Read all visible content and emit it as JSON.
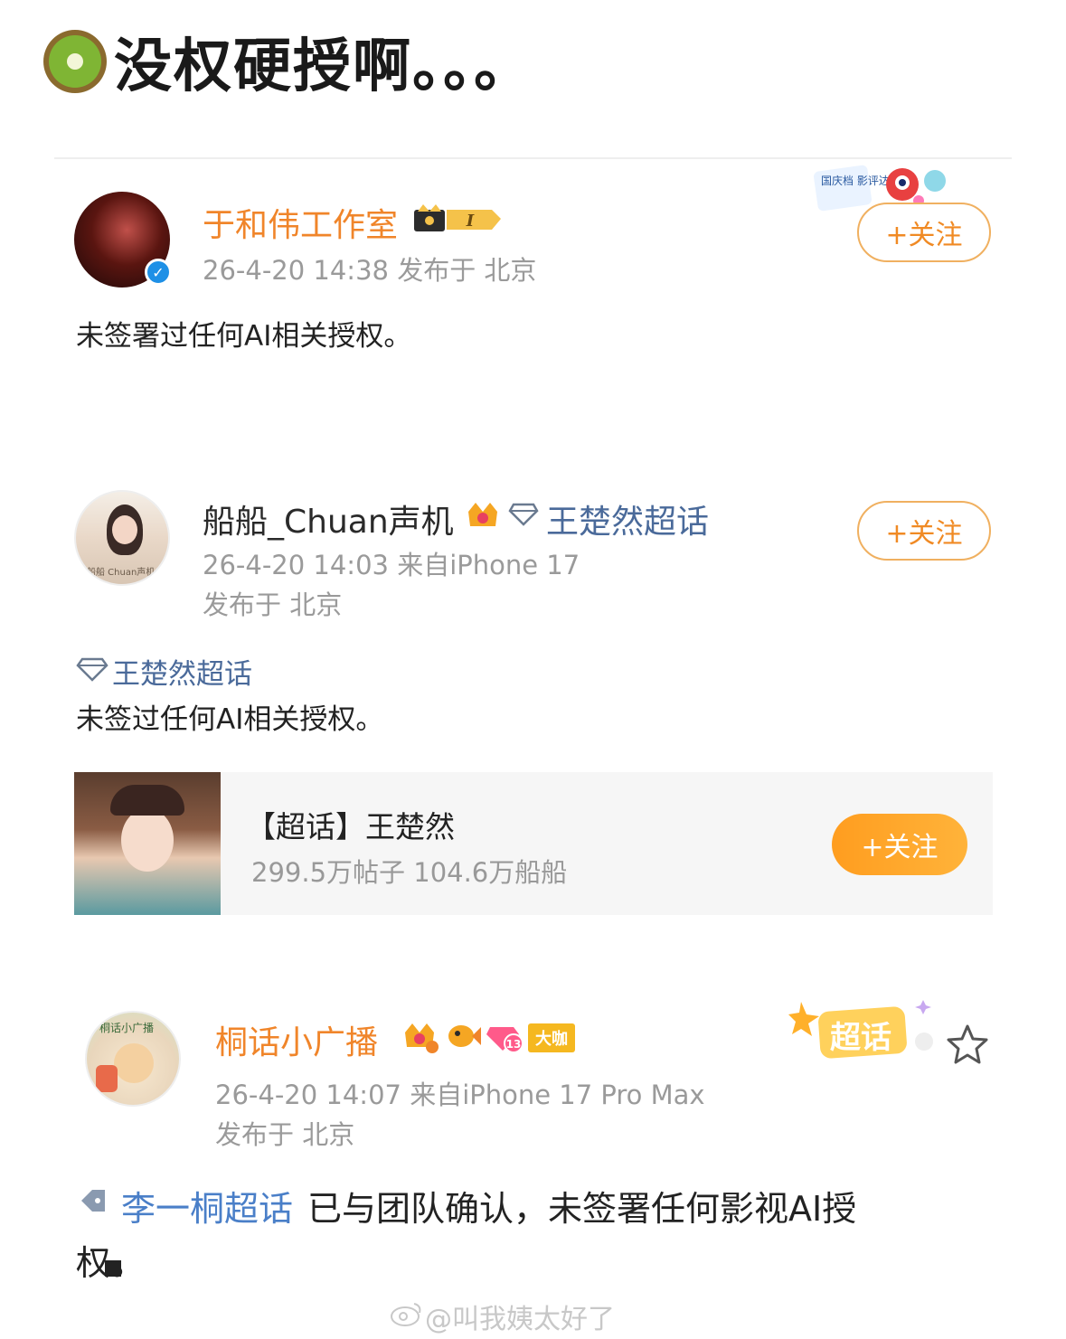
{
  "header": {
    "title": "没权硬授啊。。。",
    "icon": "kiwi-icon"
  },
  "post1": {
    "name": "于和伟工作室",
    "crown_level": "I",
    "meta": "26-4-20 14:38  发布于 北京",
    "content": "未签署过任何AI相关授权。",
    "follow": "+关注",
    "sticker_text": "国庆档 影评达人"
  },
  "post2": {
    "name": "船船_Chuan声机",
    "topic": "王楚然超话",
    "meta1": "26-4-20 14:03  来自iPhone 17",
    "meta2": "发布于 北京",
    "topic_line": "王楚然超话",
    "content": "未签过任何AI相关授权。",
    "follow": "+关注",
    "avatar_caption": "船船 Chuan声机",
    "card": {
      "title": "【超话】王楚然",
      "stats": "299.5万帖子 104.6万船船",
      "follow": "+关注"
    }
  },
  "post3": {
    "name": "桐话小广播",
    "badge_level": "13",
    "badge_vip": "大咖",
    "sticker": "超话",
    "meta1": "26-4-20 14:07  来自iPhone 17 Pro Max",
    "meta2": "发布于 北京",
    "topic": "李一桐超话",
    "content_line1": " 已与团队确认，未签署任何影视AI授",
    "content_line2": "权。",
    "avatar_caption": "桐话小广播"
  },
  "watermark": "@叫我姨太好了",
  "colors": {
    "accent": "#f0852a",
    "follow_border": "#f0b060",
    "meta": "#9a9a9a",
    "topic_blue": "#4a7fc8"
  }
}
